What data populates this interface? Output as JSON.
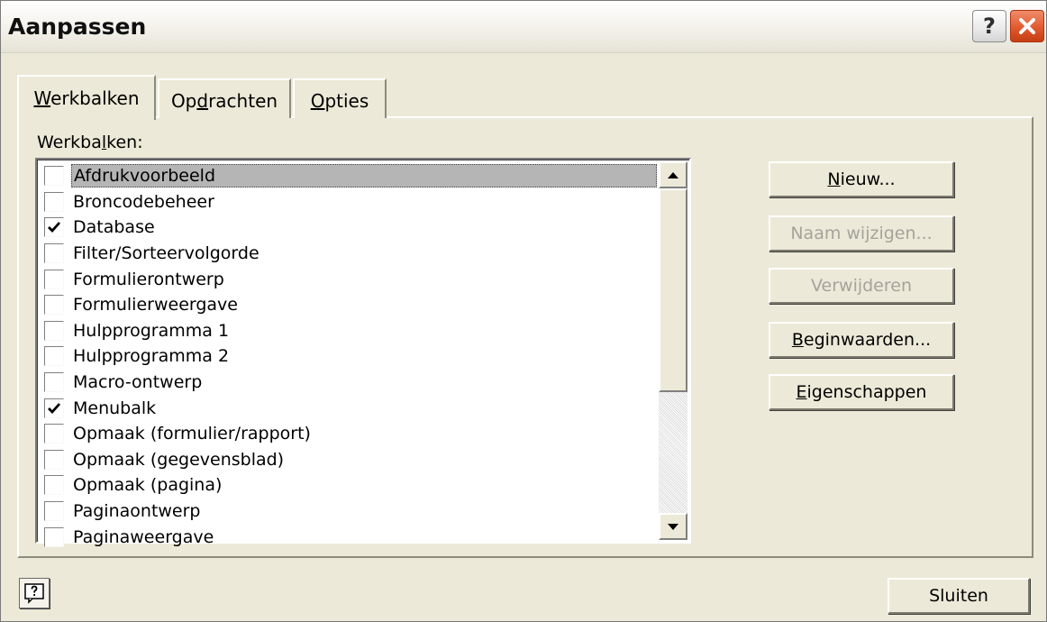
{
  "window": {
    "title": "Aanpassen",
    "help_glyph": "?",
    "close_icon": "close-x-icon"
  },
  "tabs": [
    {
      "pre": "",
      "mnemonic": "W",
      "post": "erkbalken",
      "active": true
    },
    {
      "pre": "Op",
      "mnemonic": "d",
      "post": "rachten",
      "active": false
    },
    {
      "pre": "",
      "mnemonic": "O",
      "post": "pties",
      "active": false
    }
  ],
  "toolbars_label": {
    "pre": "Werkba",
    "mnemonic": "l",
    "post": "ken:"
  },
  "toolbars": [
    {
      "label": "Afdrukvoorbeeld",
      "checked": false,
      "selected": true
    },
    {
      "label": "Broncodebeheer",
      "checked": false
    },
    {
      "label": "Database",
      "checked": true
    },
    {
      "label": "Filter/Sorteervolgorde",
      "checked": false
    },
    {
      "label": "Formulierontwerp",
      "checked": false
    },
    {
      "label": "Formulierweergave",
      "checked": false
    },
    {
      "label": "Hulpprogramma 1",
      "checked": false
    },
    {
      "label": "Hulpprogramma 2",
      "checked": false
    },
    {
      "label": "Macro-ontwerp",
      "checked": false
    },
    {
      "label": "Menubalk",
      "checked": true
    },
    {
      "label": "Opmaak (formulier/rapport)",
      "checked": false
    },
    {
      "label": "Opmaak (gegevensblad)",
      "checked": false
    },
    {
      "label": "Opmaak (pagina)",
      "checked": false
    },
    {
      "label": "Paginaontwerp",
      "checked": false
    },
    {
      "label": "Paginaweergave",
      "checked": false
    }
  ],
  "buttons": {
    "new": {
      "pre": "",
      "mnemonic": "N",
      "post": "ieuw..."
    },
    "rename": {
      "label": "Naam wijzigen...",
      "enabled": false
    },
    "delete": {
      "label": "Verwijderen",
      "enabled": false
    },
    "reset": {
      "pre": "",
      "mnemonic": "B",
      "post": "eginwaarden..."
    },
    "properties": {
      "pre": "",
      "mnemonic": "E",
      "post": "igenschappen"
    },
    "close": "Sluiten"
  },
  "colors": {
    "dialog_bg": "#ece9d8",
    "selection_bg": "#b5b5b5",
    "close_button": "#e05a30",
    "disabled_text": "#a6a39a"
  }
}
